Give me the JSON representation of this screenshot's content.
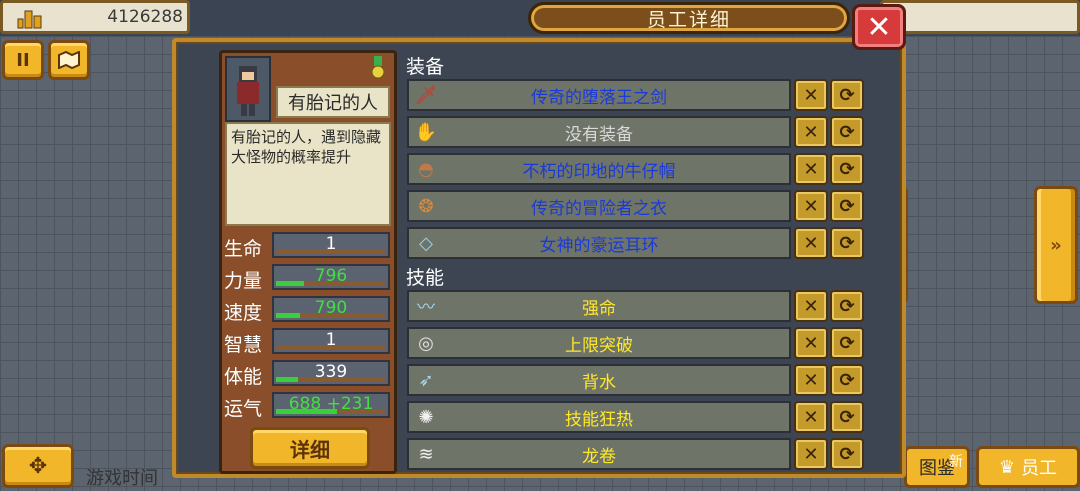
{
  "hud": {
    "money": "4126288",
    "pause_icon": "pause-icon",
    "map_icon": "map-icon",
    "move_icon": "dpad-icon"
  },
  "dialog": {
    "title": "员工详细",
    "close_icon": "close-icon",
    "prev_icon": "chevron-left-icon",
    "next_icon": "chevron-right-icon"
  },
  "character": {
    "name": "有胎记的人",
    "description": "有胎记的人，遇到隐藏大怪物的概率提升",
    "detail_button": "详细",
    "stats": [
      {
        "label": "生命",
        "value": "1",
        "fill": 0.0,
        "color": "#ffffff"
      },
      {
        "label": "力量",
        "value": "796",
        "fill": 0.25,
        "color": "#3fe03f"
      },
      {
        "label": "速度",
        "value": "790",
        "fill": 0.22,
        "color": "#3fe03f"
      },
      {
        "label": "智慧",
        "value": "1",
        "fill": 0.0,
        "color": "#ffffff"
      },
      {
        "label": "体能",
        "value": "339",
        "fill": 0.2,
        "color": "#ffffff"
      },
      {
        "label": "运气",
        "value": "688 +231",
        "fill": 0.55,
        "color": "#3fe03f"
      }
    ]
  },
  "equipment": {
    "label": "装备",
    "items": [
      {
        "name": "传奇的堕落王之剑",
        "icon": "sword-icon",
        "color": "#1a3ad8"
      },
      {
        "name": "没有装备",
        "icon": "glove-icon",
        "color": "#d8d8d8"
      },
      {
        "name": "不朽的印地的牛仔帽",
        "icon": "hat-icon",
        "color": "#1a3ad8"
      },
      {
        "name": "传奇的冒险者之衣",
        "icon": "armor-icon",
        "color": "#1a3ad8"
      },
      {
        "name": "女神的豪运耳环",
        "icon": "earring-icon",
        "color": "#1a3ad8"
      }
    ]
  },
  "skills": {
    "label": "技能",
    "items": [
      {
        "name": "强命",
        "icon": "wing-icon",
        "color": "#ffe82a"
      },
      {
        "name": "上限突破",
        "icon": "ring-icon",
        "color": "#ffe82a"
      },
      {
        "name": "背水",
        "icon": "blade-icon",
        "color": "#ffe82a"
      },
      {
        "name": "技能狂热",
        "icon": "orb-icon",
        "color": "#ffe82a"
      },
      {
        "name": "龙卷",
        "icon": "tornado-icon",
        "color": "#ffe82a"
      }
    ]
  },
  "row_actions": {
    "remove_icon": "remove-icon",
    "swap_icon": "swap-icon"
  },
  "footer": {
    "game_time": "游戏时间",
    "illustrated": "图鉴",
    "new_badge": "新",
    "staff": "员工"
  }
}
